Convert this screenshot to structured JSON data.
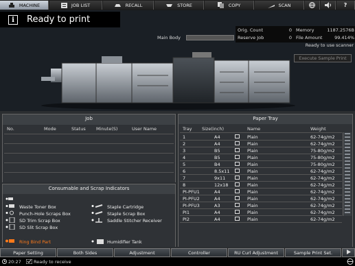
{
  "topbar": {
    "tabs": [
      {
        "label": "MACHINE",
        "icon": "printer-icon"
      },
      {
        "label": "JOB LIST",
        "icon": "list-icon"
      },
      {
        "label": "RECALL",
        "icon": "recall-icon"
      },
      {
        "label": "STORE",
        "icon": "store-icon"
      },
      {
        "label": "COPY",
        "icon": "copy-icon"
      },
      {
        "label": "SCAN",
        "icon": "scan-icon"
      }
    ],
    "icons": [
      "globe-icon",
      "speaker-icon",
      "help-icon"
    ],
    "help_label": "?"
  },
  "status": {
    "info_glyph": "i",
    "message": "Ready to print",
    "main_body_label": "Main Body",
    "orig_count_label": "Orig. Count",
    "orig_count_value": "0",
    "memory_label": "Memory",
    "memory_value": "1187.2576B",
    "reserve_job_label": "Reserve Job",
    "reserve_job_value": "0",
    "file_amount_label": "File Amount",
    "file_amount_value": "99.414%",
    "scanner_status": "Ready to use scanner",
    "execute_sample_label": "Execute Sample Print"
  },
  "job_panel": {
    "title": "Job",
    "columns": [
      "No.",
      "Mode",
      "Status",
      "Minute(S)",
      "User Name"
    ]
  },
  "paper_tray": {
    "title": "Paper Tray",
    "columns": [
      "Tray",
      "Size(inch)",
      "Name",
      "Weight"
    ],
    "rows": [
      {
        "tray": "1",
        "size": "A4",
        "name": "Plain",
        "weight": "62-74g/m2"
      },
      {
        "tray": "2",
        "size": "A4",
        "name": "Plain",
        "weight": "62-74g/m2"
      },
      {
        "tray": "3",
        "size": "B5",
        "name": "Plain",
        "weight": "75-80g/m2"
      },
      {
        "tray": "4",
        "size": "B5",
        "name": "Plain",
        "weight": "75-80g/m2"
      },
      {
        "tray": "5",
        "size": "B4",
        "name": "Plain",
        "weight": "75-80g/m2"
      },
      {
        "tray": "6",
        "size": "8.5x11",
        "name": "Plain",
        "weight": "62-74g/m2"
      },
      {
        "tray": "7",
        "size": "9x11",
        "name": "Plain",
        "weight": "62-74g/m2"
      },
      {
        "tray": "8",
        "size": "12x18",
        "name": "Plain",
        "weight": "62-74g/m2"
      },
      {
        "tray": "PI-PFU1",
        "size": "A4",
        "name": "Plain",
        "weight": "62-74g/m2"
      },
      {
        "tray": "PI-PFU2",
        "size": "A4",
        "name": "Plain",
        "weight": "62-74g/m2"
      },
      {
        "tray": "PI-PFU3",
        "size": "A3",
        "name": "Plain",
        "weight": "62-74g/m2"
      },
      {
        "tray": "PI1",
        "size": "A4",
        "name": "Plain",
        "weight": "62-74g/m2"
      },
      {
        "tray": "PI2",
        "size": "A4",
        "name": "Plain",
        "weight": "62-74g/m2"
      }
    ]
  },
  "consumables": {
    "title": "Consumable and Scrap Indicators",
    "left": [
      {
        "label": "",
        "icon": "toner-icon"
      },
      {
        "label": "Waste Toner Box",
        "icon": "waste-toner-icon"
      },
      {
        "label": "Punch-Hole Scraps Box",
        "icon": "punch-icon"
      },
      {
        "label": "SD Trim Scrap Box",
        "icon": "trim-icon"
      },
      {
        "label": "SD Slit Scrap Box",
        "icon": "slit-icon"
      }
    ],
    "right": [
      {
        "label": "Staple Cartridge",
        "icon": "staple-icon"
      },
      {
        "label": "Staple Scrap Box",
        "icon": "staple-scrap-icon"
      },
      {
        "label": "Saddle Stitcher Receiver",
        "icon": "saddle-icon"
      }
    ],
    "ring_bind": {
      "label": "Ring Bind Part",
      "color": "#ff7a1a"
    },
    "humidifier": {
      "label": "Humidifier Tank"
    }
  },
  "bottom_buttons": [
    "Paper Setting",
    "Both Sides",
    "Adjustment",
    "Controller",
    "RU Curl Adjustment",
    "Sample Print Set."
  ],
  "footer": {
    "time": "20:27",
    "message": "Ready to receive"
  },
  "colors": {
    "accent": "#ff7a1a",
    "active_tab": "#b8c0ca"
  }
}
